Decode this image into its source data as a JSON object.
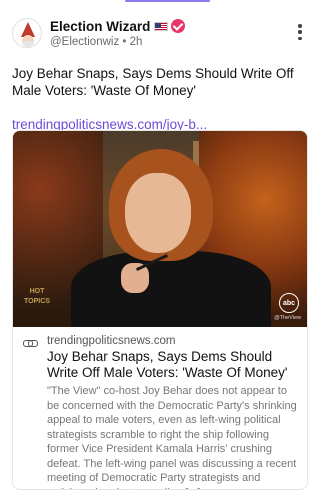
{
  "account": {
    "display_name": "Election Wizard",
    "flag": "us-flag-icon",
    "verified": true,
    "handle": "@Electionwiz",
    "separator": "•",
    "time": "2h"
  },
  "post": {
    "text": "Joy Behar Snaps, Says Dems Should Write Off Male Voters: 'Waste Of Money'",
    "link": "trendingpoliticsnews.com/joy-b..."
  },
  "card": {
    "domain": "trendingpoliticsnews.com",
    "title": "Joy Behar Snaps, Says Dems Should Write Off Male Voters: 'Waste Of Money'",
    "description": "\"The View\" co-host Joy Behar does not appear to be concerned with the Democratic Party's shrinking appeal to male voters, even as left-wing political strategists scramble to right the ship following former Vice President Kamala Harris' crushing defeat. The left-wing panel was discussing a recent meeting of Democratic Party strategists and activists aimed at appealing [...]",
    "image_overlay": {
      "show_logo": "HOT TOPICS",
      "network_logo": "abc",
      "network_handle": "@TheView"
    }
  },
  "colors": {
    "link": "#6c4bd8",
    "verified": "#e8366a",
    "accent": "#8a7cf0"
  }
}
